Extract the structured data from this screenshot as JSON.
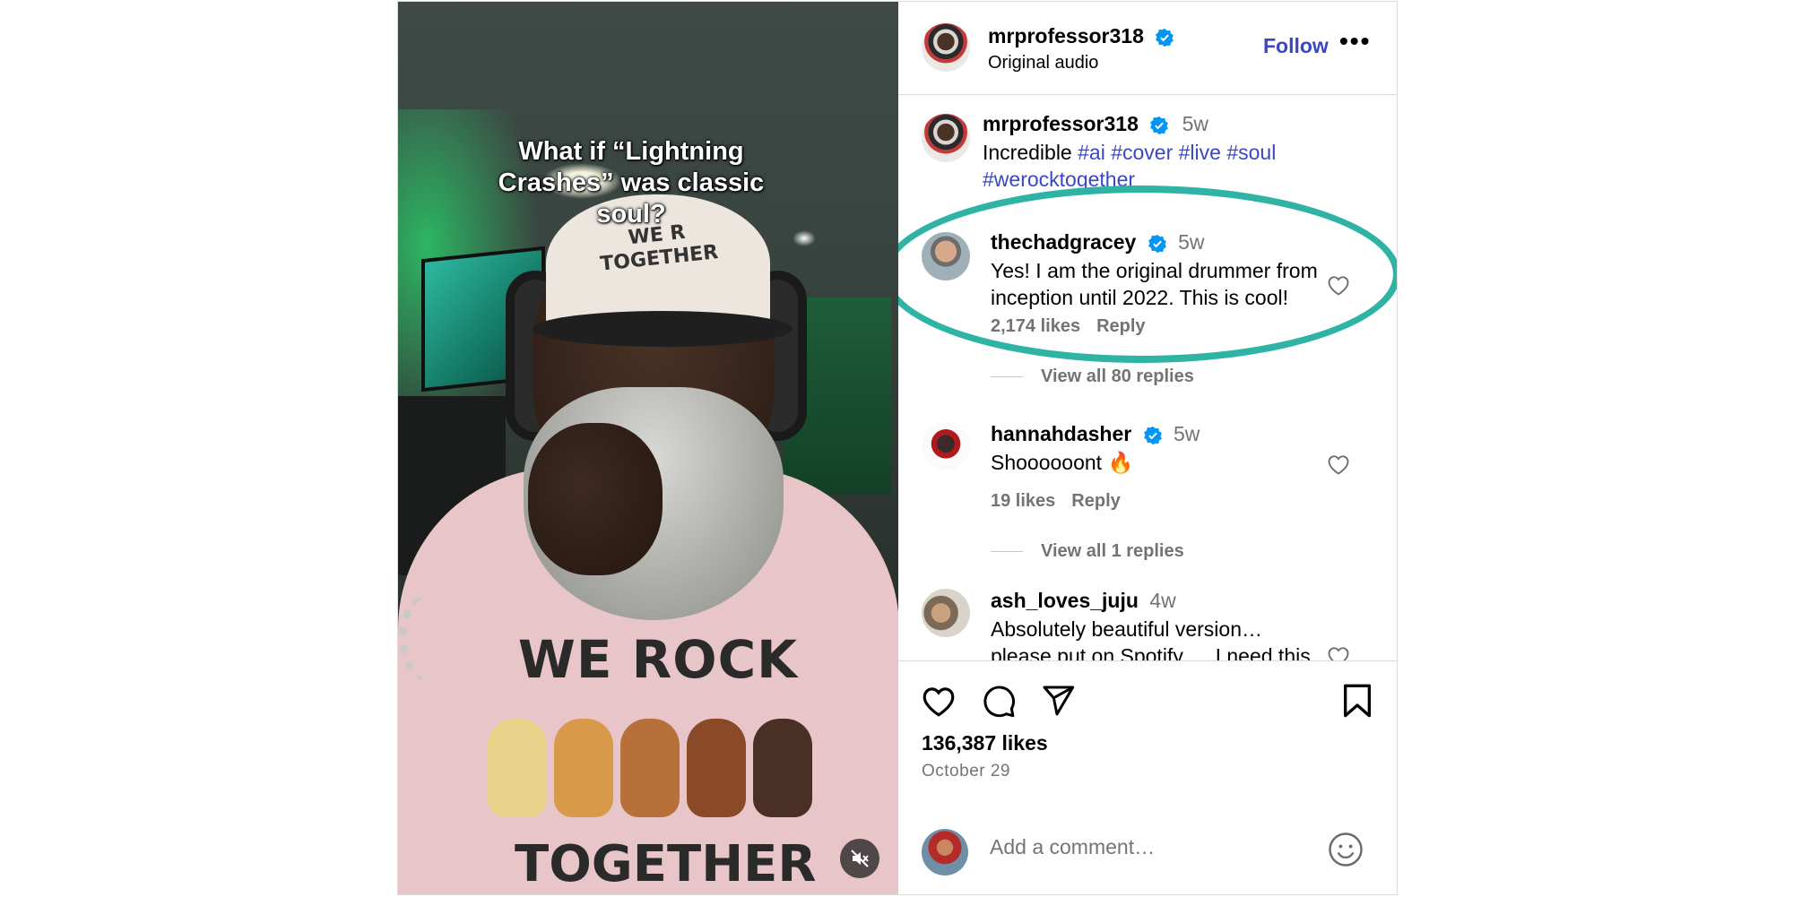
{
  "video": {
    "overlay_line1": "What if “Lightning",
    "overlay_line2": "Crashes” was classic",
    "overlay_line3": "soul?",
    "cap_text_line1": "WE R",
    "cap_text_line2": "TOGETHER",
    "shirt_line1": "WE ROCK",
    "shirt_line2": "TOGETHER",
    "mute_icon": "speaker-muted-icon"
  },
  "header": {
    "username": "mrprofessor318",
    "subtitle": "Original audio",
    "follow_label": "Follow",
    "more_label": "•••"
  },
  "caption": {
    "username": "mrprofessor318",
    "time": "5w",
    "text": "Incredible",
    "hashtags_line1": "#ai #cover #live #soul",
    "hashtags_line2": "#werocktogether"
  },
  "comments": [
    {
      "username": "thechadgracey",
      "verified": true,
      "time": "5w",
      "line1": "Yes! I am the original drummer from",
      "line2": "inception until 2022. This is cool!",
      "likes": "2,174 likes",
      "reply": "Reply",
      "view_replies": "View all 80 replies"
    },
    {
      "username": "hannahdasher",
      "verified": true,
      "time": "5w",
      "line1": "Shoooooont 🔥",
      "likes": "19 likes",
      "reply": "Reply",
      "view_replies": "View all 1 replies"
    },
    {
      "username": "ash_loves_juju",
      "verified": false,
      "time": "4w",
      "line1": "Absolutely beautiful version…",
      "line2": "please put on Spotify … I need this"
    }
  ],
  "actions": {
    "likes": "136,387 likes",
    "date": "October 29"
  },
  "add_comment": {
    "placeholder": "Add a comment…"
  },
  "colors": {
    "link": "#3a47c5",
    "verified": "#0095f6",
    "highlight": "#2fb3a5",
    "muted_text": "#737373"
  }
}
